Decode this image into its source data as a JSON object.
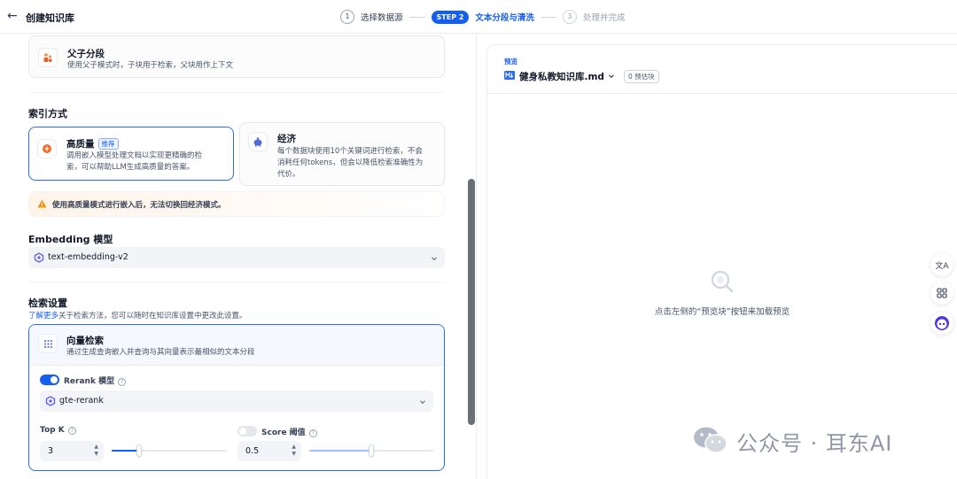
{
  "header": {
    "title": "创建知识库",
    "steps": [
      {
        "num": "1",
        "label": "选择数据源"
      },
      {
        "badge": "STEP 2",
        "label": "文本分段与清洗"
      },
      {
        "num": "3",
        "label": "处理并完成"
      }
    ]
  },
  "segment_mode": {
    "title": "父子分段",
    "desc": "使用父子模式时，子块用于检索，父块用作上下文"
  },
  "index": {
    "section_title": "索引方式",
    "high_quality": {
      "title": "高质量",
      "tag": "推荐",
      "desc_line1": "调用嵌入模型处理文档以实现更精确的检",
      "desc_line2": "索，可以帮助LLM生成高质量的答案。"
    },
    "economy": {
      "title": "经济",
      "desc_line1": "每个数据块使用10个关键词进行检索，不会",
      "desc_line2": "消耗任何tokens，但会以降低检索准确性为",
      "desc_line3": "代价。"
    },
    "warning": "使用高质量模式进行嵌入后，无法切换回经济模式。"
  },
  "embedding": {
    "section_title": "Embedding 模型",
    "model": "text-embedding-v2"
  },
  "retrieval": {
    "section_title": "检索设置",
    "help_link": "了解更多",
    "help_text": "关于检索方法，您可以随时在知识库设置中更改此设置。",
    "vector": {
      "title": "向量检索",
      "desc": "通过生成查询嵌入并查询与其向量表示最相似的文本分段"
    },
    "rerank_label": "Rerank 模型",
    "rerank_enabled": true,
    "rerank_model": "gte-rerank",
    "top_k_label": "Top K",
    "top_k_value": "3",
    "top_k_fraction": 0.24,
    "score_label": "Score 阈值",
    "score_enabled": false,
    "score_value": "0.5",
    "score_fraction": 0.5
  },
  "preview": {
    "label": "预览",
    "doc_name": "健身私教知识库.md",
    "count": "0 预估块",
    "empty_text": "点击左侧的“预览块”按钮来加载预览"
  },
  "floating": {
    "translate_label": "文A"
  },
  "watermark": {
    "text": "公众号 · 耳东AI"
  },
  "colors": {
    "accent": "#155eef",
    "warning": "#f79009",
    "text": "#101828"
  }
}
